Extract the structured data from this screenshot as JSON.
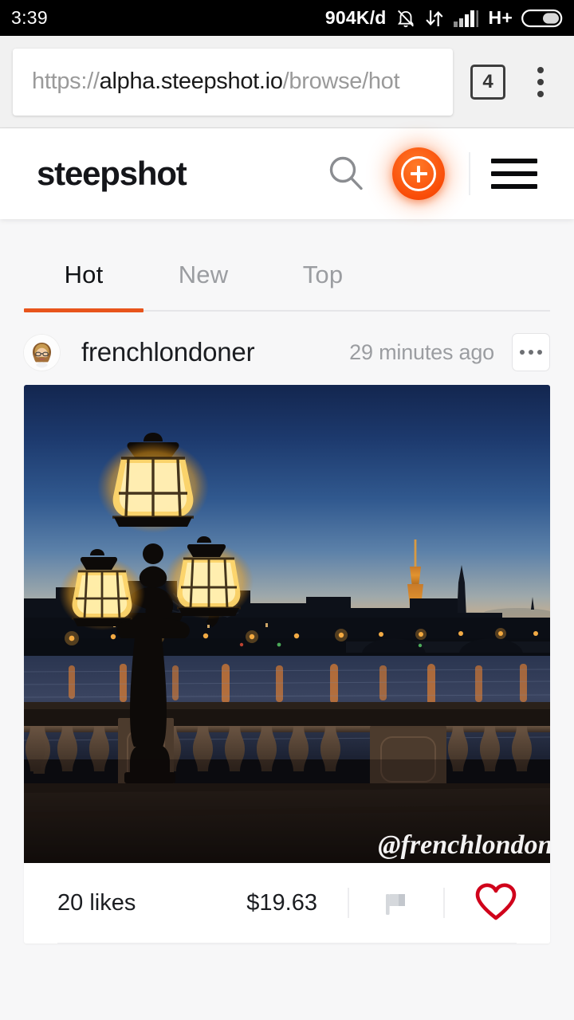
{
  "status_bar": {
    "time": "3:39",
    "data_rate": "904K/d",
    "network_type": "H+",
    "icons": [
      "notifications-off-icon",
      "data-transfer-icon",
      "signal-bars-icon",
      "battery-icon"
    ]
  },
  "browser": {
    "url_scheme": "https://",
    "url_host": "alpha.steepshot.io",
    "url_path": "/browse/hot",
    "tab_count": "4",
    "menu_icon": "kebab-menu-icon"
  },
  "app_header": {
    "logo": "steepshot",
    "search_icon": "search-icon",
    "add_icon": "plus-icon",
    "menu_icon": "hamburger-menu-icon"
  },
  "tabs": {
    "active_index": 0,
    "items": [
      {
        "label": "Hot"
      },
      {
        "label": "New"
      },
      {
        "label": "Top"
      }
    ],
    "accent_color": "#e8541c"
  },
  "post": {
    "author": "frenchlondoner",
    "avatar_name": "user-avatar",
    "timestamp": "29 minutes ago",
    "more_label": "more-options",
    "photo": {
      "alt": "Paris twilight skyline with ornate lamppost, Eiffel Tower and Seine river",
      "watermark": "@frenchlondoner"
    },
    "likes": "20 likes",
    "payout": "$19.63",
    "flag_icon": "flag-icon",
    "like_icon": "heart-icon",
    "like_color": "#d0021b",
    "flag_color": "#d5d8dc"
  }
}
